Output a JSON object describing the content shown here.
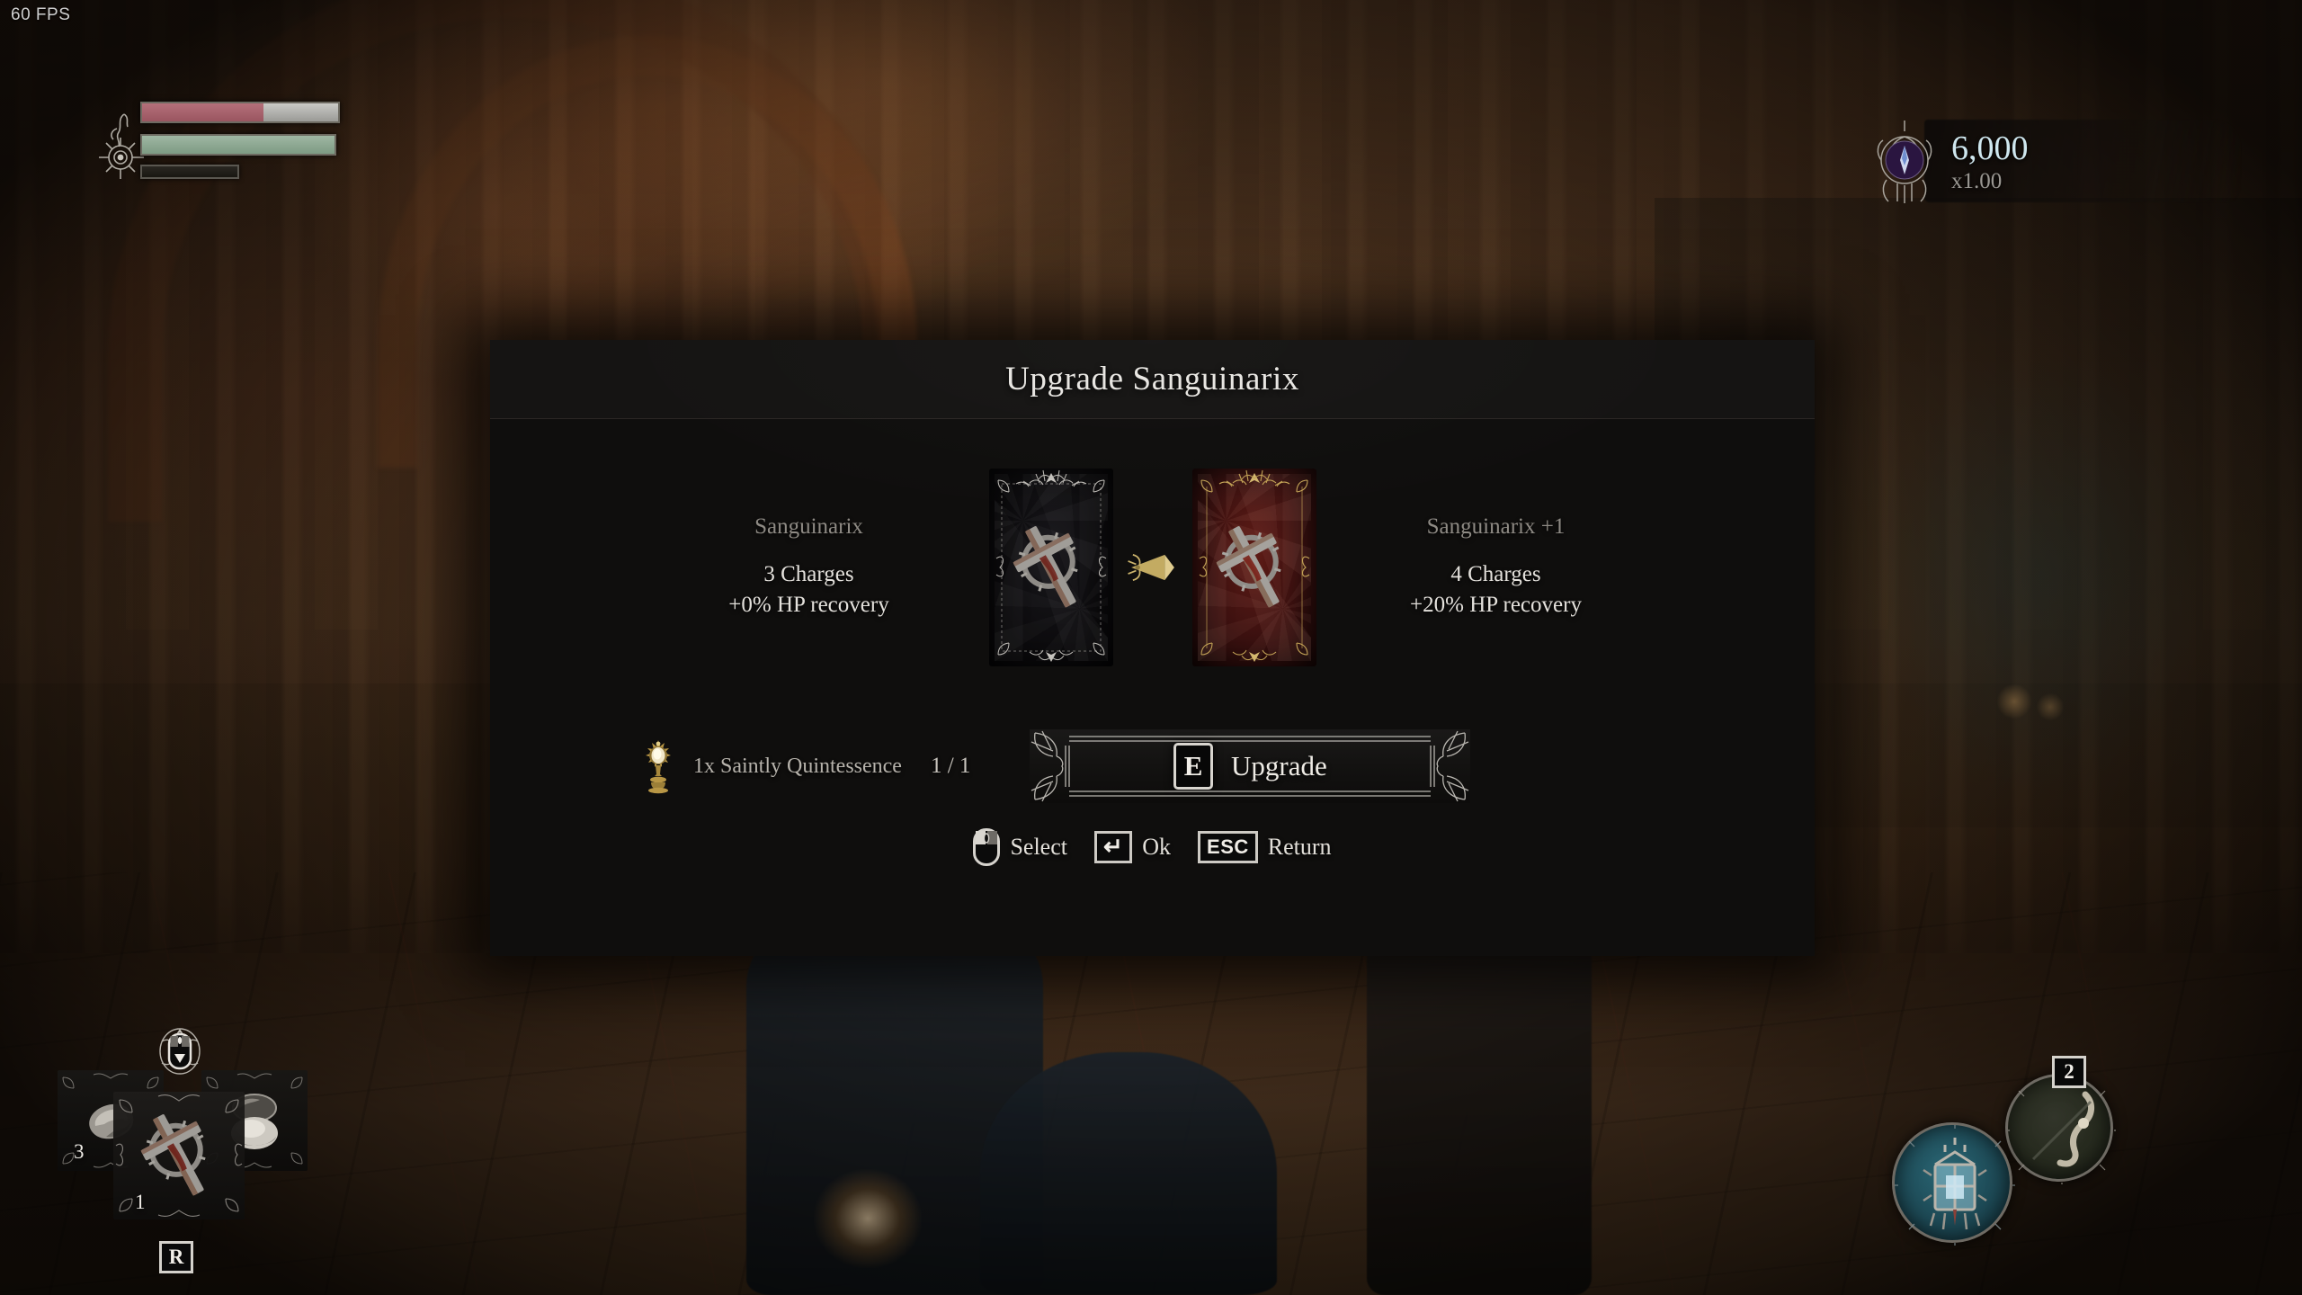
{
  "hud": {
    "fps_label": "60 FPS",
    "bars": [
      {
        "name": "health",
        "fill_percent": 62,
        "color": "#a85f6a"
      },
      {
        "name": "stamina",
        "fill_percent": 100,
        "color": "#8ea994"
      },
      {
        "name": "mana",
        "fill_percent": 8,
        "color": "#23201b"
      }
    ],
    "currency": {
      "amount": "6,000",
      "multiplier": "x1.00",
      "icon": "vigor-orb-icon",
      "amount_color": "#cfe7ef"
    },
    "quickslots": {
      "left_count": "3",
      "main_count": "1",
      "key_binding": "R",
      "cycle_icon": "cycle-down-icon",
      "items": [
        {
          "name": "stone-item",
          "slot": "left"
        },
        {
          "name": "sanguinarix-item",
          "slot": "main"
        },
        {
          "name": "consumable-item",
          "slot": "right"
        }
      ]
    },
    "spellslots": {
      "badge": "2",
      "slots": [
        {
          "name": "umbral-lamp",
          "icon": "lantern-icon",
          "color": "#1d4955"
        },
        {
          "name": "empty-catalyst",
          "icon": "bone-icon",
          "color": "#262a1e"
        }
      ]
    }
  },
  "dialog": {
    "title": "Upgrade Sanguinarix",
    "before": {
      "name": "Sanguinarix",
      "charges": "3 Charges",
      "recovery": "+0% HP recovery",
      "frame_color": "#c8c6c0",
      "bg_color": "#0b0a0c"
    },
    "after": {
      "name": "Sanguinarix +1",
      "charges": "4 Charges",
      "recovery": "+20% HP recovery",
      "frame_color": "#cbab5a",
      "bg_color": "#4a1512"
    },
    "arrow_icon": "upgrade-arrow-icon",
    "cost": {
      "icon": "saintly-quintessence-icon",
      "label": "1x Saintly Quintessence",
      "count": "1 / 1"
    },
    "action": {
      "key": "E",
      "label": "Upgrade"
    },
    "prompts": [
      {
        "icon": "mouse-icon",
        "key": "",
        "label": "Select"
      },
      {
        "icon": "",
        "key": "↵",
        "label": "Ok"
      },
      {
        "icon": "",
        "key": "ESC",
        "label": "Return"
      }
    ]
  }
}
